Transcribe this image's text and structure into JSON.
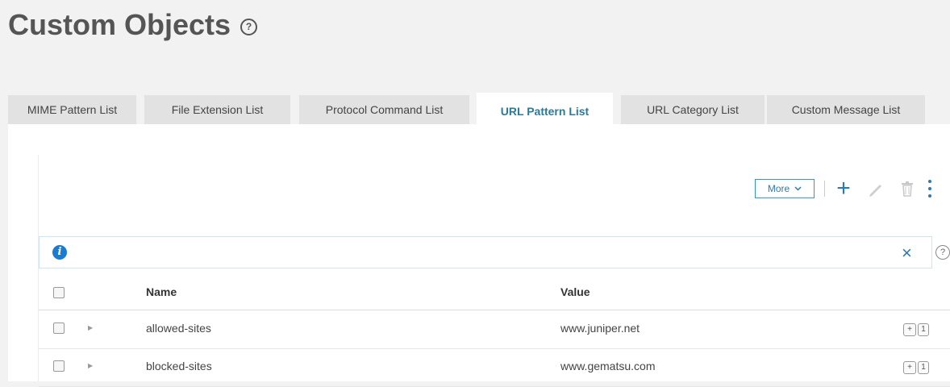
{
  "page": {
    "title": "Custom Objects",
    "help_glyph": "?"
  },
  "tabs": [
    {
      "label": "MIME Pattern List",
      "active": false
    },
    {
      "label": "File Extension List",
      "active": false
    },
    {
      "label": "Protocol Command List",
      "active": false
    },
    {
      "label": "URL Pattern List",
      "active": true
    },
    {
      "label": "URL Category List",
      "active": false
    },
    {
      "label": "Custom Message List",
      "active": false
    }
  ],
  "toolbar": {
    "more_label": "More",
    "icons": [
      "plus-icon",
      "pencil-icon",
      "trash-icon",
      "kebab-icon"
    ]
  },
  "info_bar": {
    "info_glyph": "i",
    "close_glyph": "×",
    "help_glyph": "?"
  },
  "table": {
    "columns": [
      "Name",
      "Value"
    ],
    "rows": [
      {
        "name": "allowed-sites",
        "value": "www.juniper.net",
        "badge_plus": "+",
        "badge_count": "1"
      },
      {
        "name": "blocked-sites",
        "value": "www.gematsu.com",
        "badge_plus": "+",
        "badge_count": "1"
      }
    ]
  },
  "colors": {
    "accent": "#2b7ab3",
    "active_tab_text": "#2b7a99",
    "info_icon": "#1a7bd0"
  }
}
